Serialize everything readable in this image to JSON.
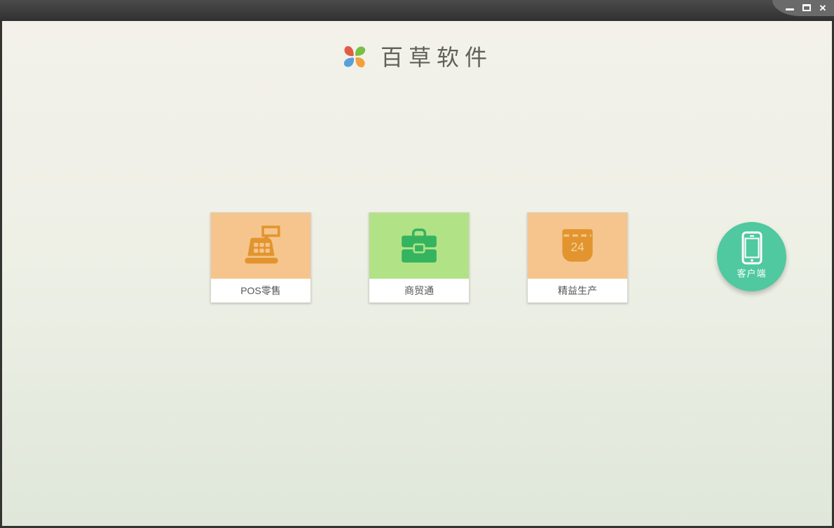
{
  "window": {
    "controls": [
      {
        "name": "minimize"
      },
      {
        "name": "maximize"
      },
      {
        "name": "close"
      }
    ],
    "titlebar_color": "#3a3a3a",
    "frame_color": "#333330"
  },
  "header": {
    "title": "百草软件",
    "logo": "pinwheel-logo",
    "logo_colors": [
      "#76c043",
      "#f2a03c",
      "#5a9fdc",
      "#e25c45"
    ]
  },
  "products": [
    {
      "label": "POS零售",
      "icon": "cash-register-icon",
      "tile_color": "#f6c58d",
      "icon_color": "#e2952e"
    },
    {
      "label": "商贸通",
      "icon": "briefcase-icon",
      "tile_color": "#b2e286",
      "icon_color": "#35b45f"
    },
    {
      "label": "精益生产",
      "icon": "calendar-icon",
      "calendar_day": "24",
      "tile_color": "#f6c58d",
      "icon_color": "#e2952e"
    }
  ],
  "client_button": {
    "label": "客户端",
    "icon": "smartphone-icon",
    "color": "#50c8a0"
  },
  "colors": {
    "background_top": "#f3f1ea",
    "background_bottom": "#dfe7da",
    "label_text": "#555555",
    "title_text": "#61615a"
  }
}
